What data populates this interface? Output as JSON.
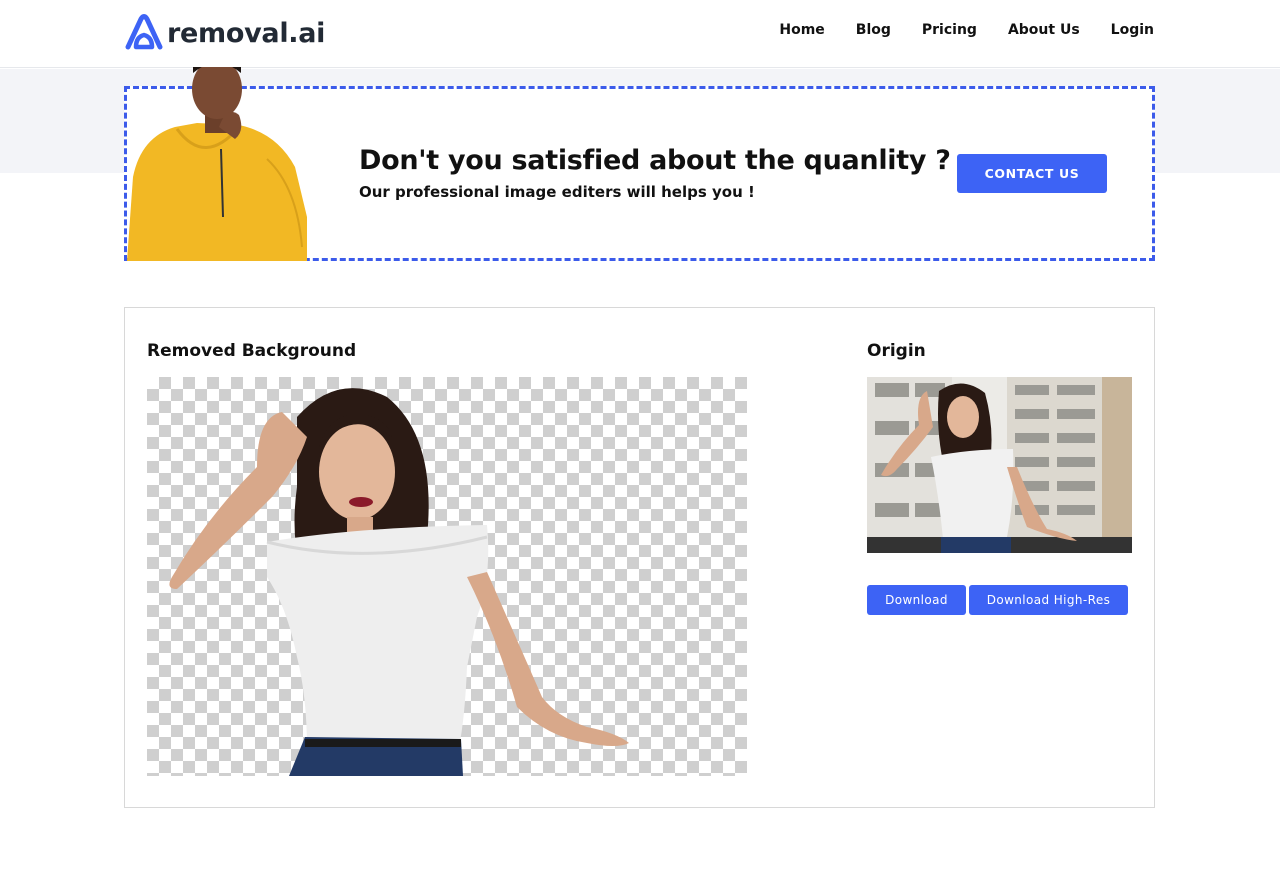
{
  "brand": {
    "name": "removal.ai",
    "accent": "#3d63f5",
    "dash_color": "#3c5bea"
  },
  "nav": {
    "items": [
      "Home",
      "Blog",
      "Pricing",
      "About Us",
      "Login"
    ]
  },
  "banner": {
    "title": "Don't you satisfied about the quanlity ?",
    "subtitle": "Our professional image editers will helps you !",
    "button": "CONTACT US"
  },
  "result": {
    "removed_title": "Removed Background",
    "origin_title": "Origin",
    "download": "Download",
    "download_hi": "Download High-Res"
  }
}
